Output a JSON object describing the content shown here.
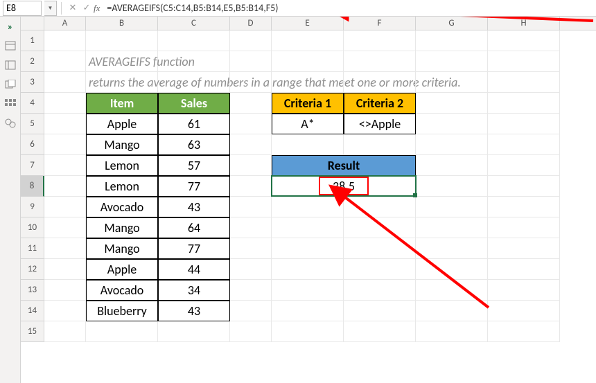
{
  "name_box": "E8",
  "formula": "=AVERAGEIFS(C5:C14,B5:B14,E5,B5:B14,F5)",
  "columns": [
    "A",
    "B",
    "C",
    "D",
    "E",
    "F",
    "G",
    "H"
  ],
  "rows": [
    "1",
    "2",
    "3",
    "4",
    "5",
    "6",
    "7",
    "8",
    "9",
    "10",
    "11",
    "12",
    "13",
    "14",
    "15"
  ],
  "desc": {
    "line1": "AVERAGEIFS function",
    "line2": "returns the average of numbers in a range that meet one or more criteria."
  },
  "table": {
    "headers": {
      "item": "Item",
      "sales": "Sales"
    },
    "rows": [
      {
        "item": "Apple",
        "sales": "61"
      },
      {
        "item": "Mango",
        "sales": "63"
      },
      {
        "item": "Lemon",
        "sales": "57"
      },
      {
        "item": "Lemon",
        "sales": "77"
      },
      {
        "item": "Avocado",
        "sales": "43"
      },
      {
        "item": "Mango",
        "sales": "64"
      },
      {
        "item": "Mango",
        "sales": "77"
      },
      {
        "item": "Apple",
        "sales": "44"
      },
      {
        "item": "Avocado",
        "sales": "34"
      },
      {
        "item": "Blueberry",
        "sales": "43"
      }
    ]
  },
  "criteria": {
    "h1": "Criteria 1",
    "h2": "Criteria 2",
    "v1": "A*",
    "v2": "<>Apple"
  },
  "result": {
    "label": "Result",
    "value": "38.5"
  }
}
